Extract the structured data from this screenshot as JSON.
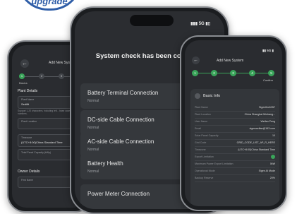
{
  "badge": {
    "label": "upgrade"
  },
  "left_phone": {
    "header_title": "Add New Syste",
    "steps": [
      "1",
      "2",
      "3",
      "4"
    ],
    "step_label": "Basics",
    "plant_section": "Plant Details",
    "fields": [
      {
        "label": "Plant Name",
        "value": "Sedifit"
      },
      {
        "label": "Plant Location",
        "value": ""
      },
      {
        "label": "Timezone",
        "value": "(UTC+8:00)China Standard Time"
      },
      {
        "label": "Total Panel Capacity (kWp)",
        "value": ""
      }
    ],
    "hint": "Support 1-20 characters, including lett... base case letters and numbers.",
    "owner_section": "Owner Details",
    "owner_field_label": "First Name"
  },
  "mid_phone": {
    "status_text": "5G",
    "heading": "System check has been completed!",
    "checks": [
      {
        "title": "Battery Terminal Connection",
        "status": "Normal"
      },
      {
        "title": "DC-side Cable Connection",
        "status": "Normal"
      },
      {
        "title": "AC-side Cable Connection",
        "status": "Normal"
      },
      {
        "title": "Battery Health",
        "status": "Normal"
      },
      {
        "title": "Power Meter Connection",
        "status": ""
      }
    ]
  },
  "right_phone": {
    "status_text": "5G",
    "header_title": "Add New System",
    "steps": [
      "1",
      "2",
      "3",
      "4",
      "5"
    ],
    "confirm_label": "Confirm",
    "card_title": "Basic Info",
    "rows": [
      {
        "label": "Plant Name",
        "value": "Sigenfied1357"
      },
      {
        "label": "Plant Location",
        "value": "China Shanghai Minhang..."
      },
      {
        "label": "User Name",
        "value": "Weifan Peng"
      },
      {
        "label": "Email",
        "value": "sigenweifan@163.com"
      },
      {
        "label": "Solar Panel Capacity",
        "value": "10"
      },
      {
        "label": "Grid Code",
        "value": "GRID_CODE_LIST_AP_R_HERE"
      },
      {
        "label": "Timezone",
        "value": "(UTC+8:00)China Standard Time"
      },
      {
        "label": "Export Limitation",
        "value": ""
      },
      {
        "label": "Maximum Power Export Limitation",
        "value": "0kW"
      },
      {
        "label": "Operational Mode",
        "value": "Sigen AI Mode"
      },
      {
        "label": "Backup Reserve",
        "value": "20%"
      }
    ],
    "accent_color": "#3aa55a"
  }
}
